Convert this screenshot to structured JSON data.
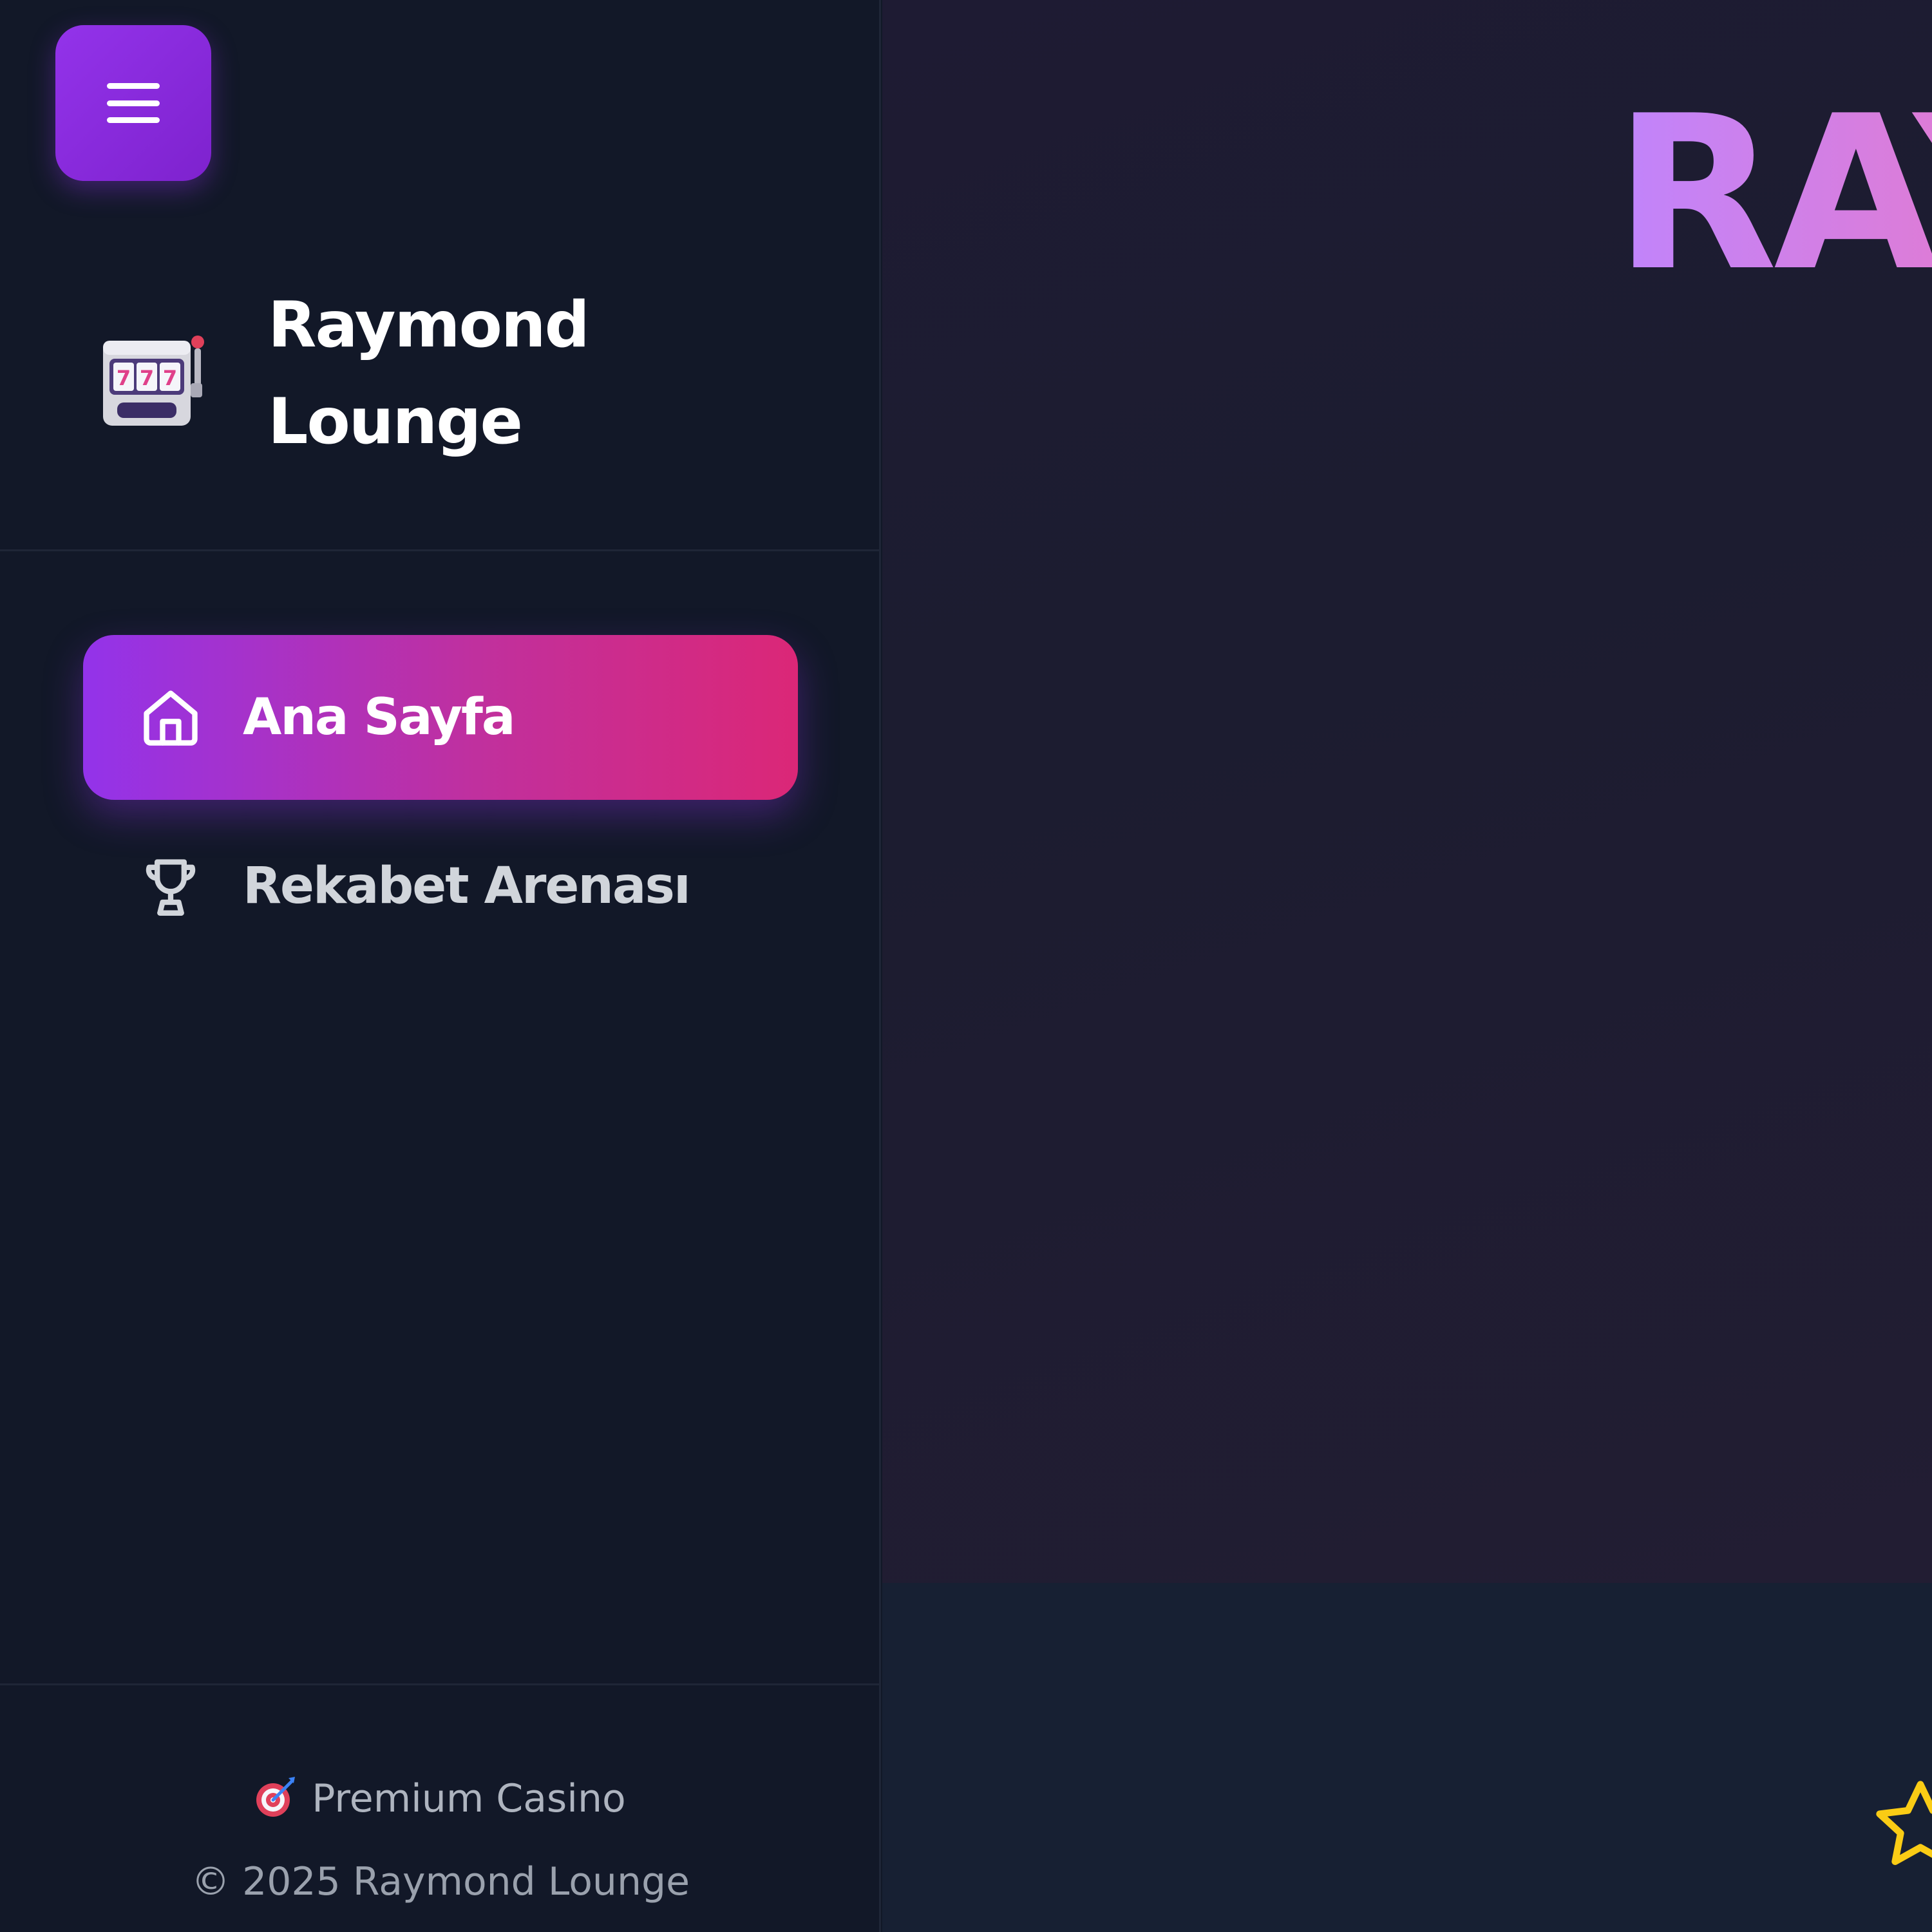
{
  "sidebar": {
    "menu_button_icon": "hamburger-menu-icon",
    "brand": {
      "icon": "slot-machine-icon",
      "name_line1": "Raymond",
      "name_line2": "Lounge"
    },
    "nav": [
      {
        "label": "Ana Sayfa",
        "icon": "home-icon",
        "active": true
      },
      {
        "label": "Rekabet Arenası",
        "icon": "trophy-icon",
        "active": false
      }
    ],
    "footer": {
      "tag_icon": "dart-target-icon",
      "tag_text": "Premium Casino",
      "copyright": "© 2025 Raymond Lounge"
    }
  },
  "main": {
    "hero_title": "RAY",
    "star_icon": "star-icon"
  },
  "colors": {
    "accent_purple": "#9333ea",
    "accent_pink": "#db2777",
    "sidebar_bg": "#121828",
    "star_yellow": "#facc15"
  }
}
